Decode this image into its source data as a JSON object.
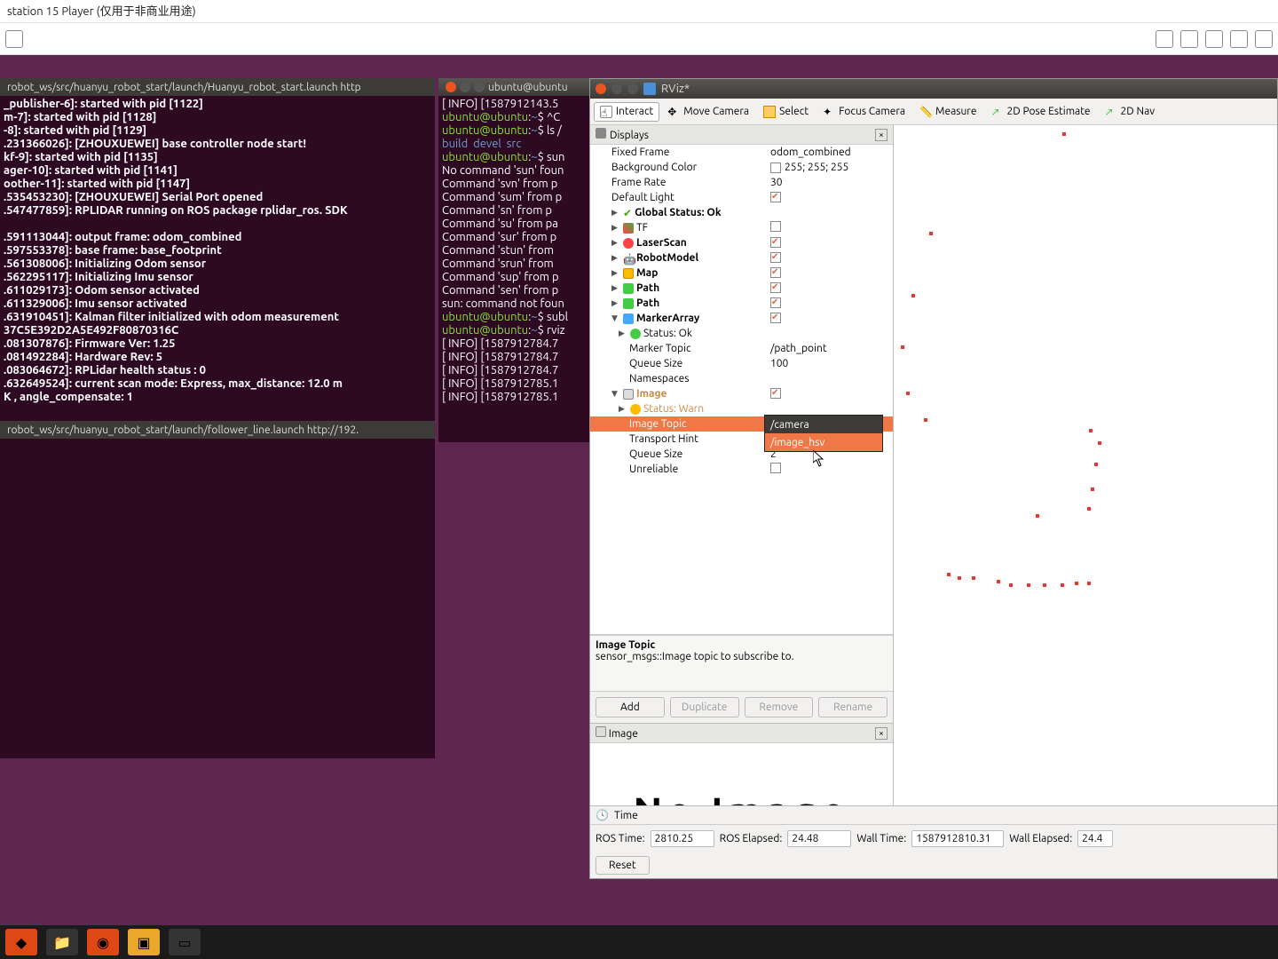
{
  "host": {
    "title": "station 15 Player (仅用于非商业用途)"
  },
  "terminals": {
    "t1_tab": "robot_ws/src/huanyu_robot_start/launch/Huanyu_robot_start.launch http",
    "t1_body": "_publisher-6]: started with pid [1122]\nm-7]: started with pid [1128]\n-8]: started with pid [1129]\n.231366026]: [ZHOUXUEWEI] base controller node start!\nkf-9]: started with pid [1135]\nager-10]: started with pid [1141]\noother-11]: started with pid [1147]\n.535453230]: [ZHOUXUEWEI] Serial Port opened\n.547477859]: RPLIDAR running on ROS package rplidar_ros. SDK\n\n.591113044]: output frame: odom_combined\n.597553378]: base frame: base_footprint\n.561308006]: Initializing Odom sensor\n.562295117]: Initializing Imu sensor\n.611029173]: Odom sensor activated\n.611329006]: Imu sensor activated\n.631910451]: Kalman filter initialized with odom measurement\n37C5E392D2A5E492F80870316C\n.081307876]: Firmware Ver: 1.25\n.081492284]: Hardware Rev: 5\n.083064672]: RPLidar health status : 0\n.632649524]: current scan mode: Express, max_distance: 12.0 m\nK , angle_compensate: 1",
    "t2_title": "ubuntu@ubuntu",
    "t2_lines": [
      "[ INFO] [1587912143.5",
      "ubuntu@ubuntu:~$ ^C",
      "ubuntu@ubuntu:~$ ls /",
      "build  devel  src",
      "ubuntu@ubuntu:~$ sun",
      "No command 'sun' foun",
      "Command 'svn' from p",
      "Command 'sum' from p",
      "Command 'sn' from p",
      "Command 'su' from pa",
      "Command 'sur' from p",
      "Command 'stun' from",
      "Command 'srun' from",
      "Command 'sup' from p",
      "Command 'sen' from p",
      "sun: command not foun",
      "ubuntu@ubuntu:~$ subl",
      "ubuntu@ubuntu:~$ rviz",
      "[ INFO] [1587912784.7",
      "[ INFO] [1587912784.7",
      "[ INFO] [1587912784.7",
      "[ INFO] [1587912785.1",
      "[ INFO] [1587912785.1"
    ],
    "t3_tab": "robot_ws/src/huanyu_robot_start/launch/follower_line.launch http://192."
  },
  "rviz": {
    "title": "RViz*",
    "toolbar": [
      "Interact",
      "Move Camera",
      "Select",
      "Focus Camera",
      "Measure",
      "2D Pose Estimate",
      "2D Nav"
    ],
    "displays_label": "Displays",
    "props": {
      "fixed_frame": {
        "label": "Fixed Frame",
        "value": "odom_combined"
      },
      "bg_color": {
        "label": "Background Color",
        "value": "255; 255; 255"
      },
      "frame_rate": {
        "label": "Frame Rate",
        "value": "30"
      },
      "default_light": {
        "label": "Default Light"
      },
      "global_status": {
        "label": "Global Status: Ok"
      },
      "tf": {
        "label": "TF"
      },
      "laserscan": {
        "label": "LaserScan"
      },
      "robotmodel": {
        "label": "RobotModel"
      },
      "map": {
        "label": "Map"
      },
      "path1": {
        "label": "Path"
      },
      "path2": {
        "label": "Path"
      },
      "markerarray": {
        "label": "MarkerArray"
      },
      "ma_status": {
        "label": "Status: Ok"
      },
      "marker_topic": {
        "label": "Marker Topic",
        "value": "/path_point"
      },
      "queue_size": {
        "label": "Queue Size",
        "value": "100"
      },
      "namespaces": {
        "label": "Namespaces"
      },
      "image": {
        "label": "Image"
      },
      "img_status": {
        "label": "Status: Warn"
      },
      "image_topic": {
        "label": "Image Topic"
      },
      "transport_hint": {
        "label": "Transport Hint"
      },
      "img_queue": {
        "label": "Queue Size",
        "value": "2"
      },
      "unreliable": {
        "label": "Unreliable"
      }
    },
    "dropdown": {
      "opt1": "/camera",
      "opt2": "/image_hsv"
    },
    "desc": {
      "title": "Image Topic",
      "text": "sensor_msgs::Image topic to subscribe to."
    },
    "buttons": {
      "add": "Add",
      "duplicate": "Duplicate",
      "remove": "Remove",
      "rename": "Rename"
    },
    "image_panel_label": "Image",
    "no_image": "No Image",
    "time": {
      "label": "Time",
      "ros_time_label": "ROS Time:",
      "ros_time": "2810.25",
      "ros_elapsed_label": "ROS Elapsed:",
      "ros_elapsed": "24.48",
      "wall_time_label": "Wall Time:",
      "wall_time": "1587912810.31",
      "wall_elapsed_label": "Wall Elapsed:",
      "wall_elapsed": "24.4",
      "reset": "Reset"
    }
  }
}
